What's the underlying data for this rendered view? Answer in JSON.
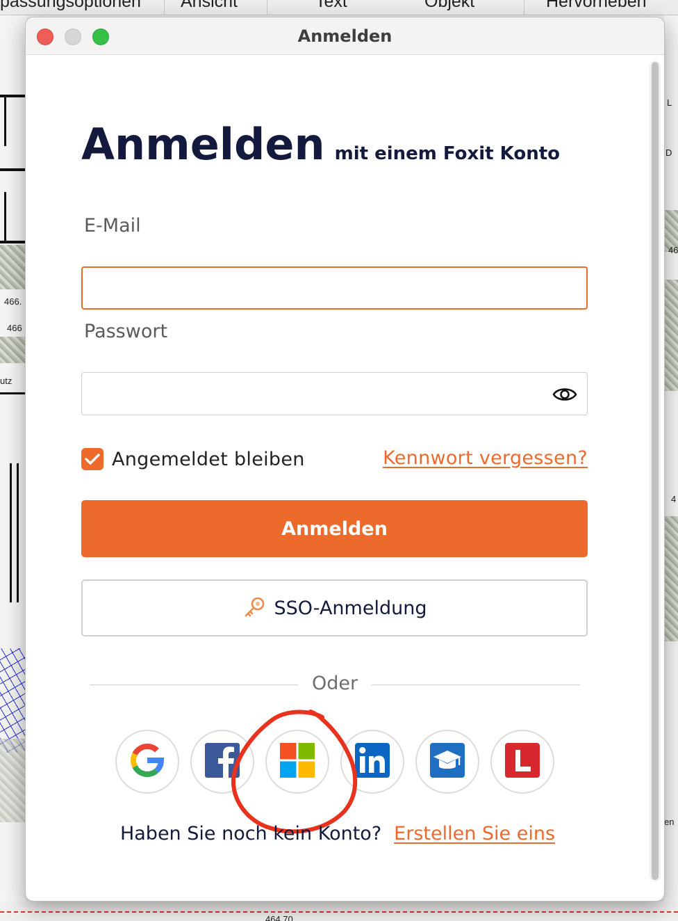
{
  "background_app": {
    "toolbar_tabs": [
      "passungsoptionen",
      "Ansicht",
      "Text",
      "Objekt",
      "Hervorheben"
    ],
    "doc_numbers": [
      "466.",
      "466",
      "utz",
      "464.70",
      "46",
      "4",
      "D",
      "L",
      "en"
    ]
  },
  "window": {
    "title": "Anmelden"
  },
  "login": {
    "heading": "Anmelden",
    "heading_sub": "mit einem Foxit Konto",
    "email_label": "E-Mail",
    "email_value": "",
    "password_label": "Passwort",
    "password_value": "",
    "remember_label": "Angemeldet bleiben",
    "remember_checked": true,
    "forgot_link": "Kennwort vergessen?",
    "submit_label": "Anmelden",
    "sso_label": "SSO-Anmeldung",
    "or_text": "Oder",
    "social_providers": [
      "google-icon",
      "facebook-icon",
      "microsoft-icon",
      "linkedin-icon",
      "education-icon",
      "l-icon"
    ],
    "no_account_text": "Haben Sie noch kein Konto?",
    "create_link": "Erstellen Sie eins"
  },
  "colors": {
    "accent": "#ec6a2c",
    "heading": "#141a3d",
    "annotation": "#e8321e"
  }
}
